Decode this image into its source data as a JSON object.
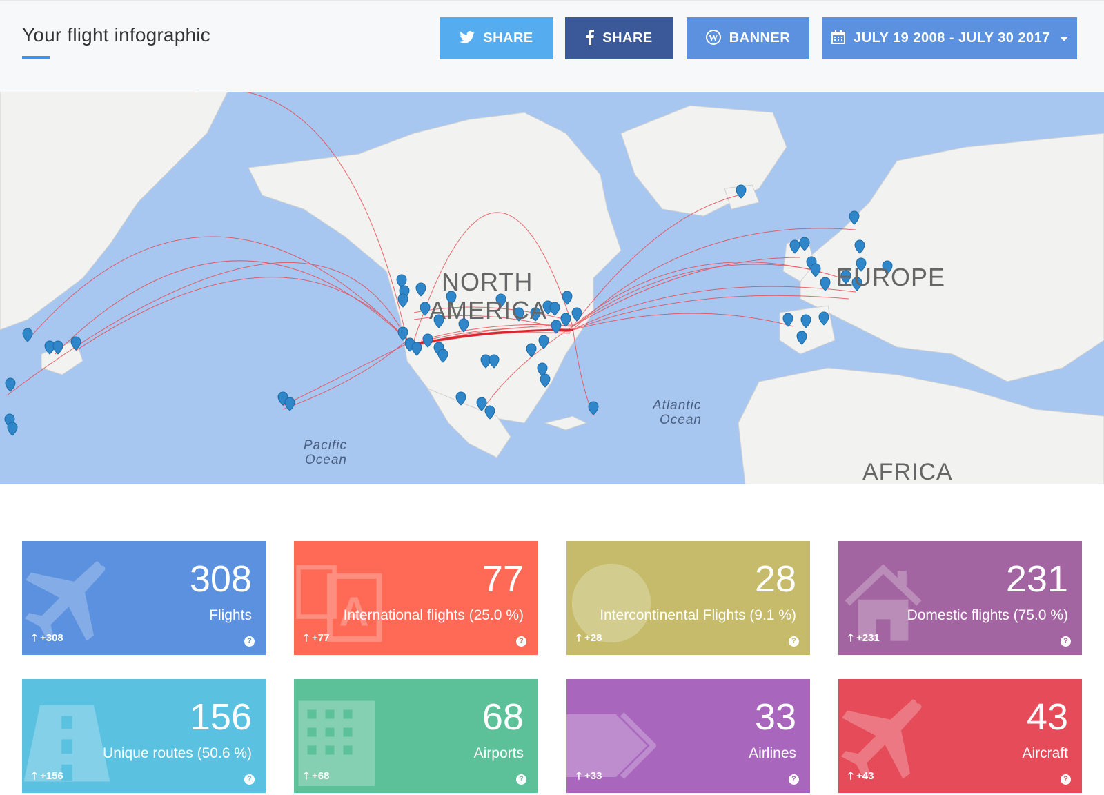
{
  "header": {
    "title": "Your flight infographic",
    "twitter_share": "SHARE",
    "facebook_share": "SHARE",
    "banner": "BANNER",
    "date_range": "JULY 19 2008 - JULY 30 2017"
  },
  "map": {
    "labels": {
      "north_america_1": "NORTH",
      "north_america_2": "AMERICA",
      "europe": "EUROPE",
      "atlantic_1": "Atlantic",
      "atlantic_2": "Ocean",
      "pacific_1": "Pacific",
      "pacific_2": "Ocean",
      "africa": "AFRICA"
    }
  },
  "stats": [
    {
      "value": "308",
      "label": "Flights",
      "delta": "+308",
      "color": "#5b91de",
      "icon": "plane-icon"
    },
    {
      "value": "77",
      "label": "International flights (25.0 %)",
      "delta": "+77",
      "color": "#fe6a56",
      "icon": "translate-icon"
    },
    {
      "value": "28",
      "label": "Intercontinental Flights (9.1 %)",
      "delta": "+28",
      "color": "#c5bb6a",
      "icon": "globe-icon"
    },
    {
      "value": "231",
      "label": "Domestic flights (75.0 %)",
      "delta": "+231",
      "color": "#a365a1",
      "icon": "home-icon"
    },
    {
      "value": "156",
      "label": "Unique routes (50.6 %)",
      "delta": "+156",
      "color": "#5bc1e1",
      "icon": "road-icon"
    },
    {
      "value": "68",
      "label": "Airports",
      "delta": "+68",
      "color": "#5cc199",
      "icon": "building-icon"
    },
    {
      "value": "33",
      "label": "Airlines",
      "delta": "+33",
      "color": "#a867bd",
      "icon": "tags-icon"
    },
    {
      "value": "43",
      "label": "Aircraft",
      "delta": "+43",
      "color": "#e54b58",
      "icon": "plane-icon"
    }
  ],
  "help_glyph": "?",
  "up_arrow": "🡑"
}
